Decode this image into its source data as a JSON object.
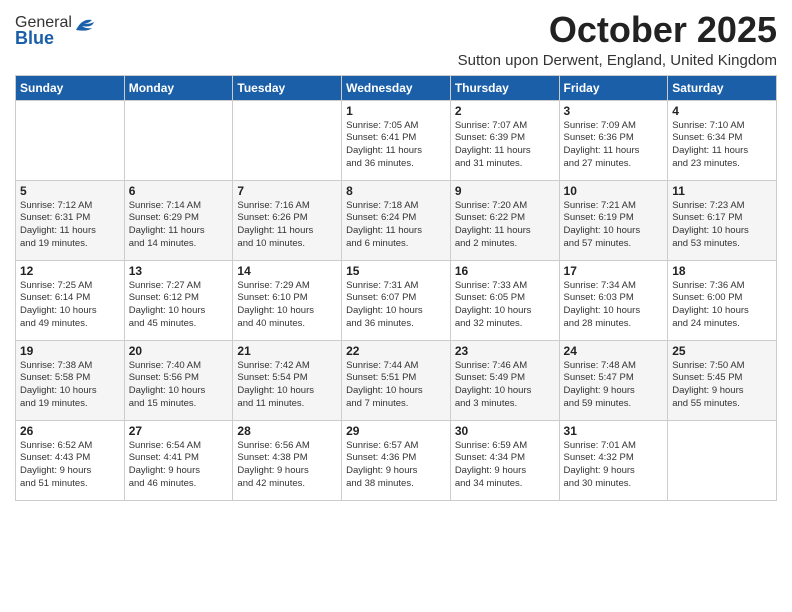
{
  "header": {
    "logo_general": "General",
    "logo_blue": "Blue",
    "month_title": "October 2025",
    "subtitle": "Sutton upon Derwent, England, United Kingdom"
  },
  "days_of_week": [
    "Sunday",
    "Monday",
    "Tuesday",
    "Wednesday",
    "Thursday",
    "Friday",
    "Saturday"
  ],
  "weeks": [
    [
      {
        "day": "",
        "info": ""
      },
      {
        "day": "",
        "info": ""
      },
      {
        "day": "",
        "info": ""
      },
      {
        "day": "1",
        "info": "Sunrise: 7:05 AM\nSunset: 6:41 PM\nDaylight: 11 hours\nand 36 minutes."
      },
      {
        "day": "2",
        "info": "Sunrise: 7:07 AM\nSunset: 6:39 PM\nDaylight: 11 hours\nand 31 minutes."
      },
      {
        "day": "3",
        "info": "Sunrise: 7:09 AM\nSunset: 6:36 PM\nDaylight: 11 hours\nand 27 minutes."
      },
      {
        "day": "4",
        "info": "Sunrise: 7:10 AM\nSunset: 6:34 PM\nDaylight: 11 hours\nand 23 minutes."
      }
    ],
    [
      {
        "day": "5",
        "info": "Sunrise: 7:12 AM\nSunset: 6:31 PM\nDaylight: 11 hours\nand 19 minutes."
      },
      {
        "day": "6",
        "info": "Sunrise: 7:14 AM\nSunset: 6:29 PM\nDaylight: 11 hours\nand 14 minutes."
      },
      {
        "day": "7",
        "info": "Sunrise: 7:16 AM\nSunset: 6:26 PM\nDaylight: 11 hours\nand 10 minutes."
      },
      {
        "day": "8",
        "info": "Sunrise: 7:18 AM\nSunset: 6:24 PM\nDaylight: 11 hours\nand 6 minutes."
      },
      {
        "day": "9",
        "info": "Sunrise: 7:20 AM\nSunset: 6:22 PM\nDaylight: 11 hours\nand 2 minutes."
      },
      {
        "day": "10",
        "info": "Sunrise: 7:21 AM\nSunset: 6:19 PM\nDaylight: 10 hours\nand 57 minutes."
      },
      {
        "day": "11",
        "info": "Sunrise: 7:23 AM\nSunset: 6:17 PM\nDaylight: 10 hours\nand 53 minutes."
      }
    ],
    [
      {
        "day": "12",
        "info": "Sunrise: 7:25 AM\nSunset: 6:14 PM\nDaylight: 10 hours\nand 49 minutes."
      },
      {
        "day": "13",
        "info": "Sunrise: 7:27 AM\nSunset: 6:12 PM\nDaylight: 10 hours\nand 45 minutes."
      },
      {
        "day": "14",
        "info": "Sunrise: 7:29 AM\nSunset: 6:10 PM\nDaylight: 10 hours\nand 40 minutes."
      },
      {
        "day": "15",
        "info": "Sunrise: 7:31 AM\nSunset: 6:07 PM\nDaylight: 10 hours\nand 36 minutes."
      },
      {
        "day": "16",
        "info": "Sunrise: 7:33 AM\nSunset: 6:05 PM\nDaylight: 10 hours\nand 32 minutes."
      },
      {
        "day": "17",
        "info": "Sunrise: 7:34 AM\nSunset: 6:03 PM\nDaylight: 10 hours\nand 28 minutes."
      },
      {
        "day": "18",
        "info": "Sunrise: 7:36 AM\nSunset: 6:00 PM\nDaylight: 10 hours\nand 24 minutes."
      }
    ],
    [
      {
        "day": "19",
        "info": "Sunrise: 7:38 AM\nSunset: 5:58 PM\nDaylight: 10 hours\nand 19 minutes."
      },
      {
        "day": "20",
        "info": "Sunrise: 7:40 AM\nSunset: 5:56 PM\nDaylight: 10 hours\nand 15 minutes."
      },
      {
        "day": "21",
        "info": "Sunrise: 7:42 AM\nSunset: 5:54 PM\nDaylight: 10 hours\nand 11 minutes."
      },
      {
        "day": "22",
        "info": "Sunrise: 7:44 AM\nSunset: 5:51 PM\nDaylight: 10 hours\nand 7 minutes."
      },
      {
        "day": "23",
        "info": "Sunrise: 7:46 AM\nSunset: 5:49 PM\nDaylight: 10 hours\nand 3 minutes."
      },
      {
        "day": "24",
        "info": "Sunrise: 7:48 AM\nSunset: 5:47 PM\nDaylight: 9 hours\nand 59 minutes."
      },
      {
        "day": "25",
        "info": "Sunrise: 7:50 AM\nSunset: 5:45 PM\nDaylight: 9 hours\nand 55 minutes."
      }
    ],
    [
      {
        "day": "26",
        "info": "Sunrise: 6:52 AM\nSunset: 4:43 PM\nDaylight: 9 hours\nand 51 minutes."
      },
      {
        "day": "27",
        "info": "Sunrise: 6:54 AM\nSunset: 4:41 PM\nDaylight: 9 hours\nand 46 minutes."
      },
      {
        "day": "28",
        "info": "Sunrise: 6:56 AM\nSunset: 4:38 PM\nDaylight: 9 hours\nand 42 minutes."
      },
      {
        "day": "29",
        "info": "Sunrise: 6:57 AM\nSunset: 4:36 PM\nDaylight: 9 hours\nand 38 minutes."
      },
      {
        "day": "30",
        "info": "Sunrise: 6:59 AM\nSunset: 4:34 PM\nDaylight: 9 hours\nand 34 minutes."
      },
      {
        "day": "31",
        "info": "Sunrise: 7:01 AM\nSunset: 4:32 PM\nDaylight: 9 hours\nand 30 minutes."
      },
      {
        "day": "",
        "info": ""
      }
    ]
  ]
}
